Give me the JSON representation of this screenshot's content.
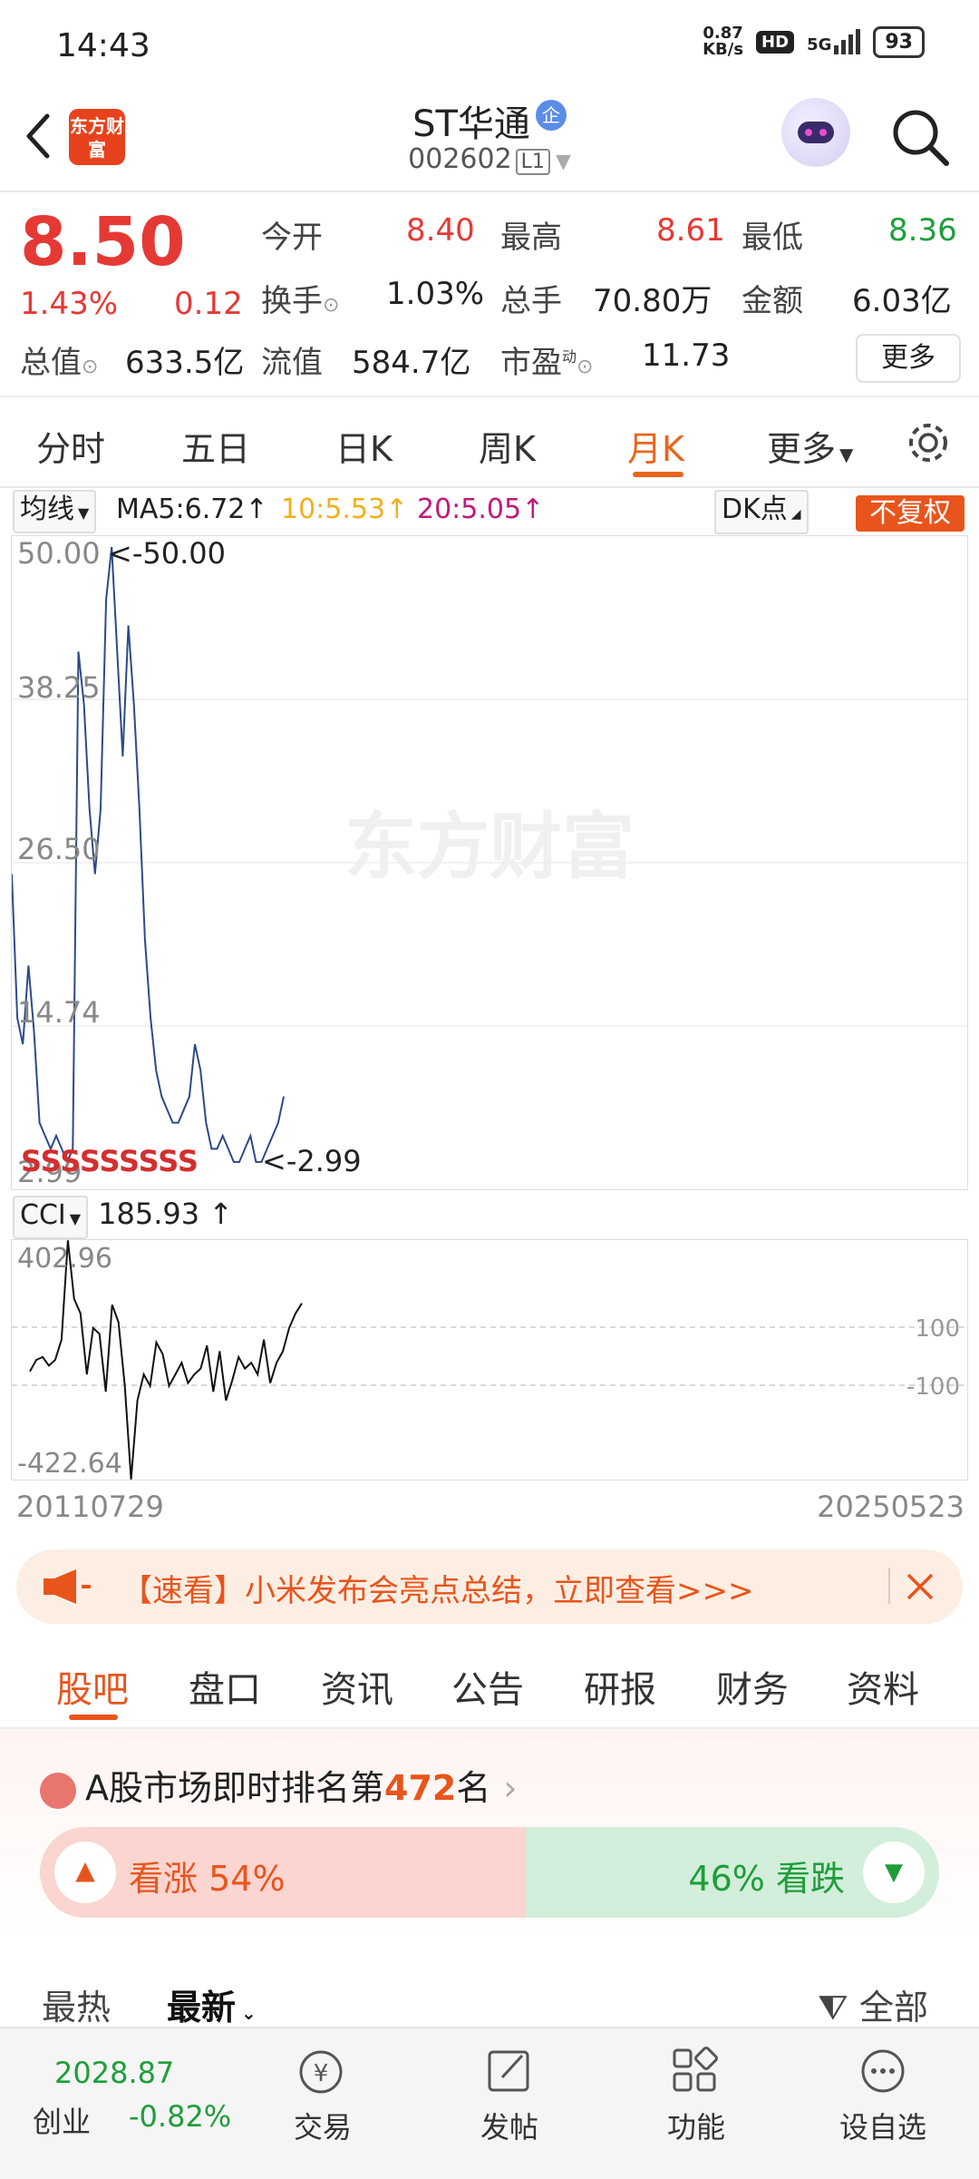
{
  "status": {
    "time": "14:43",
    "net_speed": "0.87",
    "net_unit": "KB/s",
    "hd": "HD",
    "signal": "5G",
    "battery": "93"
  },
  "header": {
    "logo_text": "东方财富",
    "title": "ST华通",
    "badge": "企",
    "code": "002602",
    "level": "L1"
  },
  "quote": {
    "price": "8.50",
    "change_pct": "1.43%",
    "change": "0.12",
    "row1": [
      {
        "label": "今开",
        "value": "8.40",
        "tone": "red"
      },
      {
        "label": "最高",
        "value": "8.61",
        "tone": "red"
      },
      {
        "label": "最低",
        "value": "8.36",
        "tone": "green"
      }
    ],
    "turnover_label": "换手",
    "turnover": "1.03%",
    "volume_label": "总手",
    "volume": "70.80万",
    "amount_label": "金额",
    "amount": "6.03亿",
    "mcap_label": "总值",
    "mcap": "633.5亿",
    "float_label": "流值",
    "float": "584.7亿",
    "pe_label": "市盈",
    "pe_sup": "动",
    "pe": "11.73",
    "more": "更多"
  },
  "period_tabs": [
    "分时",
    "五日",
    "日K",
    "周K",
    "月K",
    "更多"
  ],
  "active_period": 4,
  "ma": {
    "selector": "均线",
    "ma5": "MA5:6.72",
    "ma10": "10:5.53",
    "ma20": "20:5.05",
    "dk": "DK点",
    "fq": "不复权"
  },
  "main_chart": {
    "y_labels": [
      "50.00",
      "38.25",
      "26.50",
      "14.74",
      "2.99"
    ],
    "max_label": "<-50.00",
    "min_label": "<-2.99",
    "signals": "SSSSSSSSS",
    "watermark": "东方财富"
  },
  "cci": {
    "selector": "CCI",
    "value": "185.93",
    "top": "402.96",
    "bottom": "-422.64",
    "ref_hi": "100",
    "ref_lo": "-100"
  },
  "dates": {
    "start": "20110729",
    "end": "20250523"
  },
  "banner": {
    "text": "【速看】小米发布会亮点总结，立即查看>>>"
  },
  "info_tabs": [
    "股吧",
    "盘口",
    "资讯",
    "公告",
    "研报",
    "财务",
    "资料"
  ],
  "active_info_tab": 0,
  "rank": {
    "prefix": "A股市场即时排名第",
    "number": "472",
    "suffix": "名"
  },
  "vote": {
    "up_label": "看涨",
    "up_pct": "54%",
    "down_pct": "46%",
    "down_label": "看跌",
    "up_fraction": 0.54
  },
  "sort": {
    "hot": "最热",
    "new": "最新",
    "filter": "全部"
  },
  "bottom_nav": {
    "index_value": "2028.87",
    "index_name": "创业",
    "index_change": "-0.82%",
    "items": [
      "交易",
      "发帖",
      "功能",
      "设自选"
    ]
  },
  "colors": {
    "up": "#e53935",
    "down": "#1e9e3a",
    "accent": "#e8651c"
  },
  "chart_data": [
    {
      "type": "line",
      "title": "",
      "ylim": [
        2.99,
        50.0
      ],
      "series": [
        {
          "name": "",
          "values": [
            25,
            14,
            12,
            18,
            13,
            6,
            5,
            4,
            5,
            4,
            3,
            4,
            42,
            38,
            30,
            25,
            30,
            46,
            50,
            42,
            34,
            44,
            38,
            30,
            20,
            14,
            10,
            8,
            7,
            6,
            6,
            7,
            8,
            12,
            10,
            6,
            4,
            4,
            5,
            4,
            3,
            3,
            4,
            5,
            3,
            3,
            4,
            5,
            6,
            8
          ]
        }
      ]
    },
    {
      "type": "line",
      "title": "",
      "ylim": [
        -422.64,
        402.96
      ],
      "series": [
        {
          "name": "",
          "values": [
            -50,
            -10,
            0,
            -30,
            -10,
            60,
            402,
            200,
            150,
            -60,
            100,
            80,
            -120,
            180,
            120,
            -100,
            -422,
            -150,
            -60,
            -100,
            50,
            10,
            -100,
            -60,
            -20,
            -90,
            -60,
            -40,
            40,
            -120,
            20,
            -150,
            -80,
            0,
            -40,
            -20,
            -60,
            60,
            -90,
            -20,
            20,
            100,
            150,
            185
          ]
        }
      ]
    }
  ]
}
